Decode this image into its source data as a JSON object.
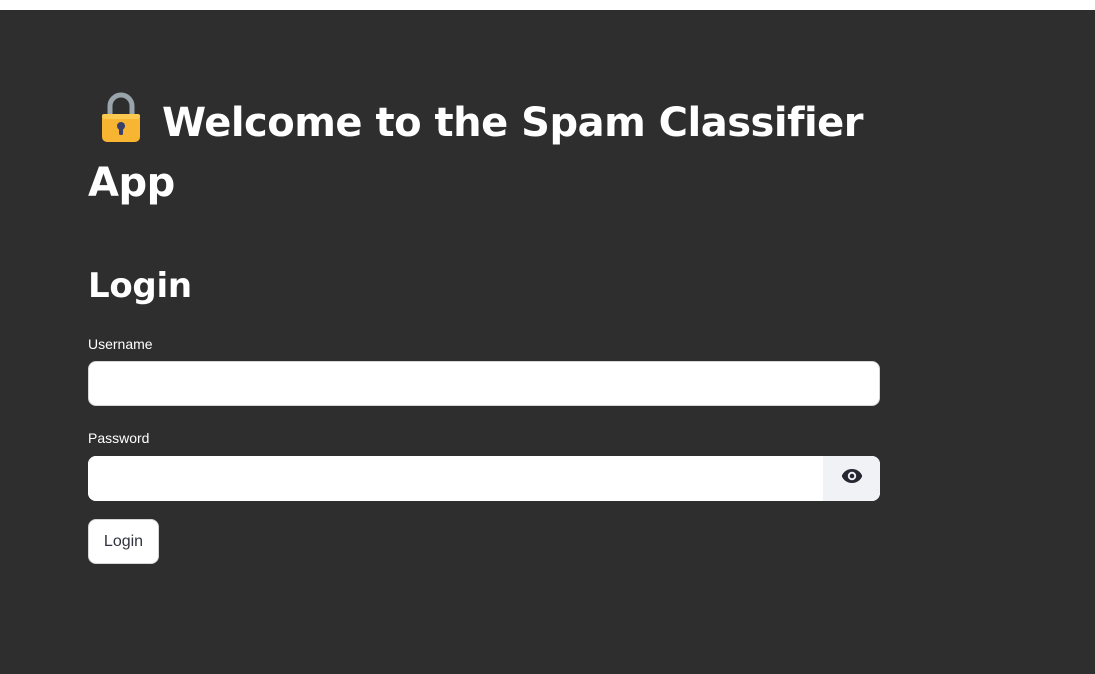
{
  "header": {
    "title_icon": "lock-icon",
    "title": "Welcome to the Spam Classifier App"
  },
  "login_section": {
    "heading": "Login",
    "username": {
      "label": "Username",
      "value": "",
      "placeholder": ""
    },
    "password": {
      "label": "Password",
      "value": "",
      "placeholder": "",
      "toggle_icon": "eye-icon"
    },
    "submit_label": "Login"
  },
  "colors": {
    "background": "#2e2e2e",
    "text": "#ffffff",
    "input_background": "#ffffff",
    "button_text": "#31333f",
    "lock_body": "#f7b531",
    "lock_shackle": "#9aa4ab"
  }
}
